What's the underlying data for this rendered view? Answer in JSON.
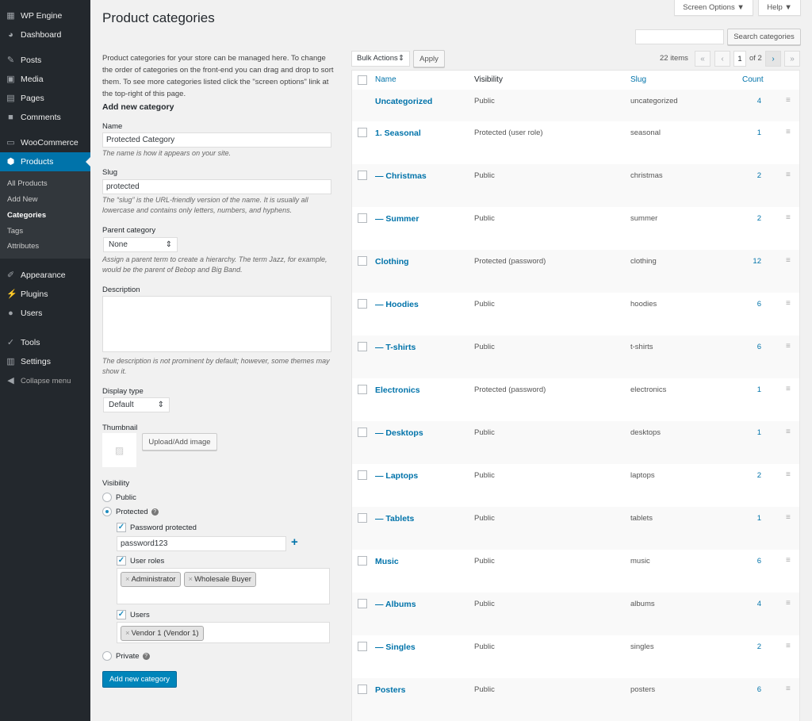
{
  "sidebar": {
    "items": [
      {
        "label": "WP Engine",
        "icon": "wp-engine-icon"
      },
      {
        "label": "Dashboard",
        "icon": "dashboard-icon"
      },
      {
        "label": "Posts",
        "icon": "pin-icon"
      },
      {
        "label": "Media",
        "icon": "media-icon"
      },
      {
        "label": "Pages",
        "icon": "pages-icon"
      },
      {
        "label": "Comments",
        "icon": "comment-icon"
      },
      {
        "label": "WooCommerce",
        "icon": "woo-icon"
      },
      {
        "label": "Products",
        "icon": "box-icon"
      },
      {
        "label": "Appearance",
        "icon": "brush-icon"
      },
      {
        "label": "Plugins",
        "icon": "plug-icon"
      },
      {
        "label": "Users",
        "icon": "user-icon"
      },
      {
        "label": "Tools",
        "icon": "wrench-icon"
      },
      {
        "label": "Settings",
        "icon": "settings-icon"
      },
      {
        "label": "Collapse menu",
        "icon": "collapse-icon"
      }
    ],
    "submenu": [
      "All Products",
      "Add New",
      "Categories",
      "Tags",
      "Attributes"
    ]
  },
  "header": {
    "title": "Product categories",
    "screen_options": "Screen Options ▼",
    "help": "Help ▼"
  },
  "intro": "Product categories for your store can be managed here. To change the order of categories on the front-end you can drag and drop to sort them. To see more categories listed click the \"screen options\" link at the top-right of this page.",
  "form": {
    "heading": "Add new category",
    "name_label": "Name",
    "name_value": "Protected Category",
    "name_help": "The name is how it appears on your site.",
    "slug_label": "Slug",
    "slug_value": "protected",
    "slug_help": "The “slug” is the URL-friendly version of the name. It is usually all lowercase and contains only letters, numbers, and hyphens.",
    "parent_label": "Parent category",
    "parent_value": "None",
    "parent_help": "Assign a parent term to create a hierarchy. The term Jazz, for example, would be the parent of Bebop and Big Band.",
    "desc_label": "Description",
    "desc_help": "The description is not prominent by default; however, some themes may show it.",
    "display_label": "Display type",
    "display_value": "Default",
    "thumb_label": "Thumbnail",
    "upload": "Upload/Add image",
    "visibility_label": "Visibility",
    "public": "Public",
    "protected": "Protected",
    "private": "Private",
    "password_protected": "Password protected",
    "password_value": "password123",
    "user_roles": "User roles",
    "roles": [
      "Administrator",
      "Wholesale Buyer"
    ],
    "users": "Users",
    "user_tags": [
      "Vendor 1 (Vendor 1)"
    ],
    "submit": "Add new category"
  },
  "search": {
    "button": "Search categories",
    "value": ""
  },
  "bulk": {
    "label": "Bulk Actions",
    "apply": "Apply"
  },
  "pagination": {
    "items": "22 items",
    "current": "1",
    "of": "of 2",
    "first": "«",
    "prev": "‹",
    "next": "›",
    "last": "»"
  },
  "table": {
    "headers": {
      "name": "Name",
      "visibility": "Visibility",
      "slug": "Slug",
      "count": "Count"
    },
    "rows": [
      {
        "name": "Uncategorized",
        "visibility": "Public",
        "slug": "uncategorized",
        "count": "4"
      },
      {
        "name": "1. Seasonal",
        "visibility": "Protected (user role)",
        "slug": "seasonal",
        "count": "1"
      },
      {
        "name": "— Christmas",
        "visibility": "Public",
        "slug": "christmas",
        "count": "2"
      },
      {
        "name": "— Summer",
        "visibility": "Public",
        "slug": "summer",
        "count": "2"
      },
      {
        "name": "Clothing",
        "visibility": "Protected (password)",
        "slug": "clothing",
        "count": "12"
      },
      {
        "name": "— Hoodies",
        "visibility": "Public",
        "slug": "hoodies",
        "count": "6"
      },
      {
        "name": "— T-shirts",
        "visibility": "Public",
        "slug": "t-shirts",
        "count": "6"
      },
      {
        "name": "Electronics",
        "visibility": "Protected (password)",
        "slug": "electronics",
        "count": "1"
      },
      {
        "name": "— Desktops",
        "visibility": "Public",
        "slug": "desktops",
        "count": "1"
      },
      {
        "name": "— Laptops",
        "visibility": "Public",
        "slug": "laptops",
        "count": "2"
      },
      {
        "name": "— Tablets",
        "visibility": "Public",
        "slug": "tablets",
        "count": "1"
      },
      {
        "name": "Music",
        "visibility": "Public",
        "slug": "music",
        "count": "6"
      },
      {
        "name": "— Albums",
        "visibility": "Public",
        "slug": "albums",
        "count": "4"
      },
      {
        "name": "— Singles",
        "visibility": "Public",
        "slug": "singles",
        "count": "2"
      },
      {
        "name": "Posters",
        "visibility": "Public",
        "slug": "posters",
        "count": "6"
      }
    ]
  }
}
